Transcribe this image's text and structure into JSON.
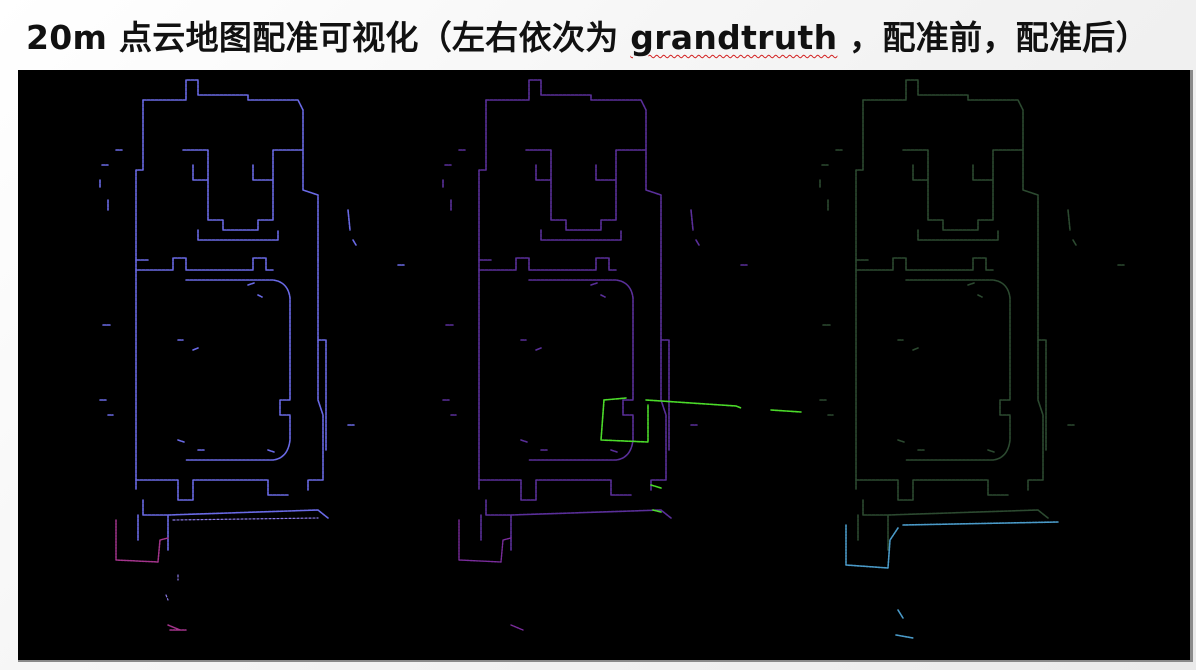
{
  "slide": {
    "title_prefix": "20m 点云地图配准可视化（左右依次为 ",
    "title_highlight": "grandtruth",
    "title_suffix": " ，配准前，配准后）"
  },
  "panels": [
    {
      "label": "",
      "color": "#6a6ae6",
      "accent": "#a4348c"
    },
    {
      "label": "",
      "color": "#5a2f9a",
      "accent": "#4cdc2a"
    },
    {
      "label": "",
      "color": "#2c4a30",
      "accent": "#4a9ac8"
    }
  ]
}
